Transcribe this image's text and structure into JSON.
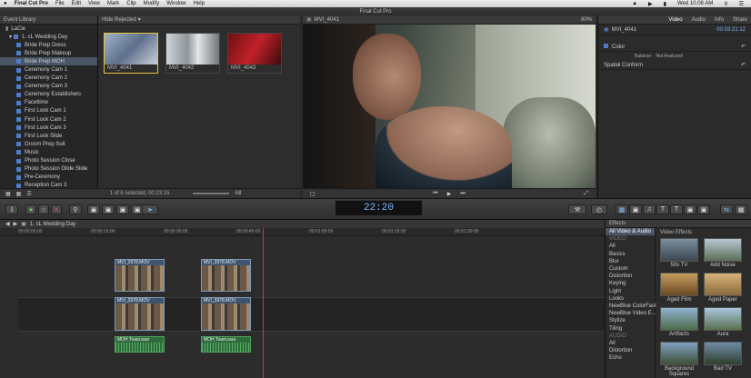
{
  "menubar": {
    "apple": "",
    "app": "Final Cut Pro",
    "items": [
      "File",
      "Edit",
      "View",
      "Mark",
      "Clip",
      "Modify",
      "Window",
      "Help"
    ],
    "clock": "Wed 10:08 AM"
  },
  "window_title": "Final Cut Pro",
  "library": {
    "header": "Event Library",
    "root": "LaCie",
    "event": "1. cL Wedding Day",
    "items": [
      "Bride Prep Dress",
      "Bride Prep Makeup",
      "Bride Prep MOH",
      "Ceremony Cam 1",
      "Ceremony Cam 2",
      "Ceremony Cam 3",
      "Ceremony Establishers",
      "Faceltime",
      "First Look Cam 1",
      "First Look Cam 2",
      "First Look Cam 3",
      "First Look Slide",
      "Groom Prep Suit",
      "Music",
      "Photo Session Close",
      "Photo Session Glide Slide",
      "Pre-Ceremony",
      "Reception Cam 3"
    ],
    "selected_index": 2
  },
  "browser": {
    "filter": "Hide Rejected",
    "clips": [
      "MVI_4041",
      "MVI_4042",
      "MVI_4043"
    ],
    "status": "1 of 6 selected, 00:23:15",
    "zoom_label": "All"
  },
  "viewer": {
    "clip_name": "MVI_4041",
    "zoom": "80%"
  },
  "inspector": {
    "tabs": [
      "Video",
      "Audio",
      "Info",
      "Share"
    ],
    "clip": "MVI_4041",
    "duration": "00:03:21:12",
    "sections": [
      "Color",
      "Spatial Conform"
    ],
    "balance_label": "Balance:",
    "balance_value": "Not Analyzed"
  },
  "timecode": "22:20",
  "timeline": {
    "project": "1. cL Wedding Day",
    "ruler": [
      "00:00:00:00",
      "00:00:15:00",
      "00:00:30:00",
      "00:00:45:00",
      "00:01:00:00",
      "00:01:15:00",
      "00:01:30:00"
    ],
    "connected_clips": [
      "MVI_3978.MOV",
      "MVI_3978.MOV"
    ],
    "primary_clips": [
      "MVI_3978.MOV",
      "MVI_3978.MOV"
    ],
    "audio_clips": [
      "MOH Toast.wav",
      "MOH Toast.wav"
    ]
  },
  "effects": {
    "title": "Effects",
    "category_header": "All Video & Audio",
    "grid_header": "Video Effects",
    "group_video": "VIDEO",
    "group_audio": "AUDIO",
    "video_categories": [
      "All",
      "Basics",
      "Blur",
      "Custom",
      "Distortion",
      "Keying",
      "Light",
      "Looks",
      "NewBlue ColorFast",
      "NewBlue Video E...",
      "Stylize",
      "Tiling"
    ],
    "audio_categories": [
      "All",
      "Distortion",
      "Echo"
    ],
    "items": [
      "50s TV",
      "Add Noise",
      "Aged Film",
      "Aged Paper",
      "Artifacts",
      "Aura",
      "Background Squares",
      "Bad TV"
    ]
  }
}
